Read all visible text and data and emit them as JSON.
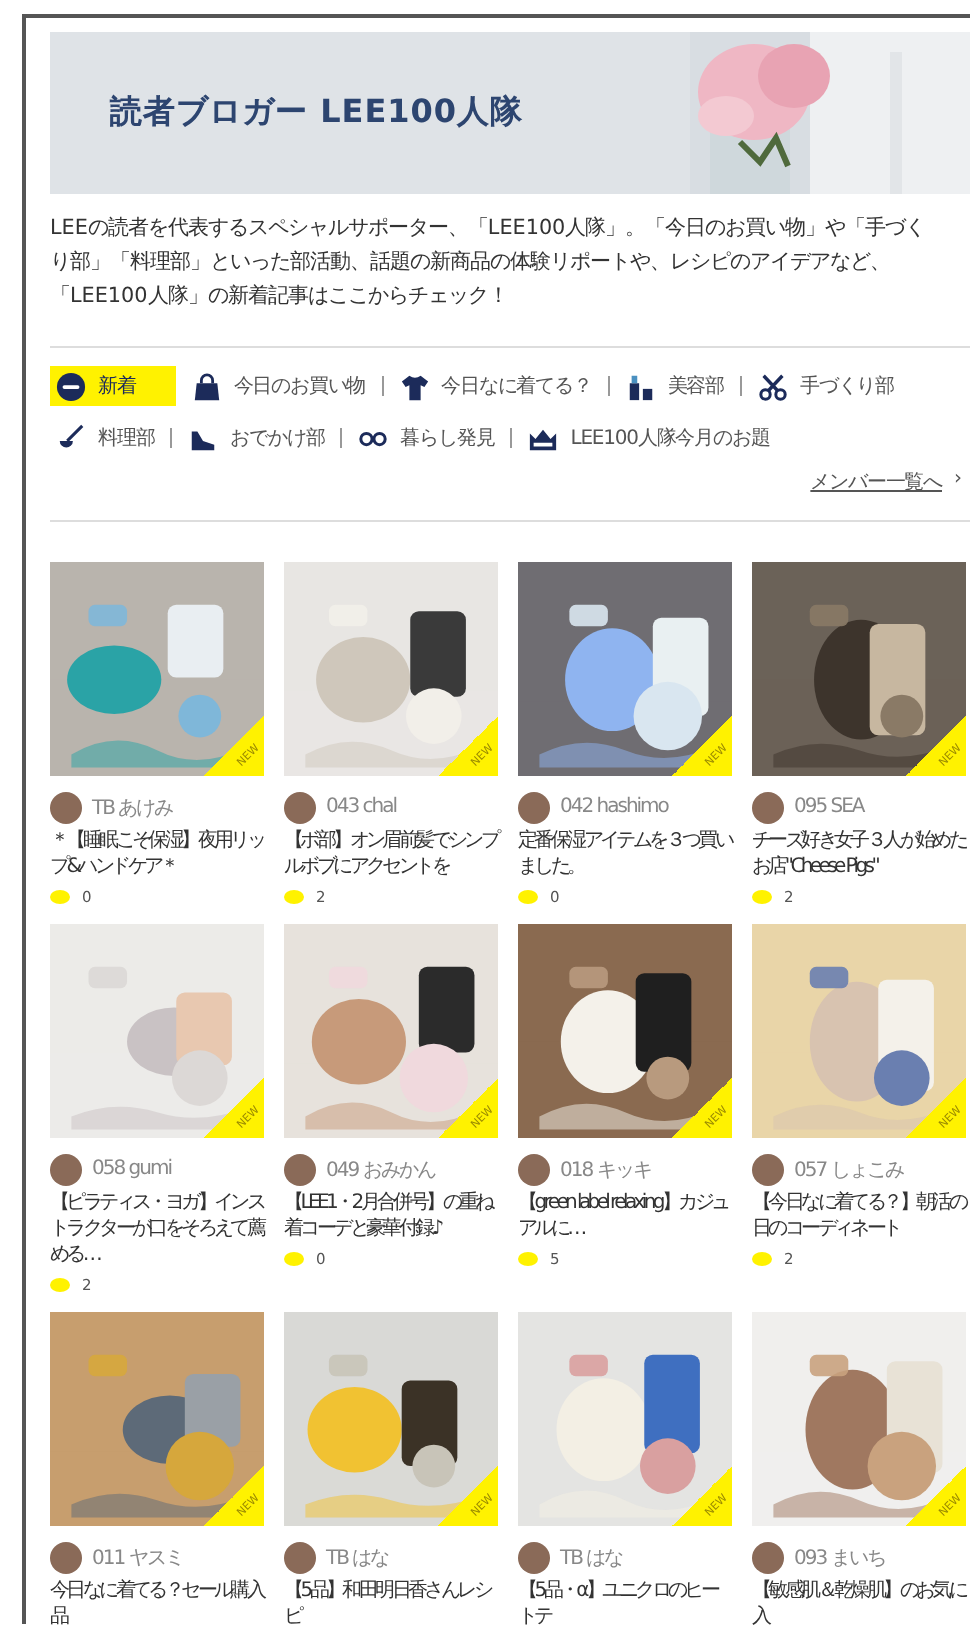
{
  "banner": {
    "title": "読者ブロガー LEE100人隊"
  },
  "description": "LEEの読者を代表するスペシャルサポーター、「LEE100人隊」。「今日のお買い物」や「手づくり部」「料理部」といった部活動、話題の新商品の体験リポートや、レシピのアイデアなど、「LEE100人隊」の新着記事はここからチェック！",
  "category_rows": [
    {
      "items": [
        {
          "kind": "new",
          "label": "新着",
          "selected": true
        },
        {
          "kind": "bag",
          "label": "今日のお買い物",
          "selected": false
        },
        {
          "kind": "shirt",
          "label": "今日なに着てる？",
          "selected": false
        },
        {
          "kind": "cosmetics",
          "label": "美容部",
          "selected": false
        },
        {
          "kind": "scissors",
          "label": "手づくり部",
          "selected": false
        }
      ]
    },
    {
      "items": [
        {
          "kind": "ladle",
          "label": "料理部",
          "selected": false
        },
        {
          "kind": "shoe",
          "label": "おでかけ部",
          "selected": false
        },
        {
          "kind": "glasses",
          "label": "暮らし発見",
          "selected": false
        },
        {
          "kind": "crown",
          "label": "LEE100人隊今月のお題",
          "selected": false
        }
      ]
    }
  ],
  "member_link": {
    "label": "メンバー一覧へ",
    "arrow": "›"
  },
  "posts": [
    {
      "badge": "NEW",
      "author": "TB あけみ",
      "title": "＊【睡眠こそ保湿】夜用リップ&ハンドケア＊",
      "comments": "0"
    },
    {
      "badge": "NEW",
      "author": "043 chal",
      "title": "【ボ部】オン眉前髪でシンプルボブにアクセントを",
      "comments": "2"
    },
    {
      "badge": "NEW",
      "author": "042 hashimo",
      "title": "定番保湿アイテムを３つ買いました。",
      "comments": "0"
    },
    {
      "badge": "NEW",
      "author": "095 SEA",
      "title": "チーズ好き女子３人が始めたお店\"Cheese Pigs\"",
      "comments": "2"
    },
    {
      "badge": "NEW",
      "author": "058 gumi",
      "title": "【ピラティス・ヨガ】インストラクターが口をそろえて薦める…",
      "comments": "2"
    },
    {
      "badge": "NEW",
      "author": "049 おみかん",
      "title": "【LEE1・2月合併号】の重ね着コーデと豪華付録♪",
      "comments": "0"
    },
    {
      "badge": "NEW",
      "author": "018 キッキ",
      "title": "【green label relaxing】カジュアルに…",
      "comments": "5"
    },
    {
      "badge": "NEW",
      "author": "057 しょこみ",
      "title": "【今日なに着てる？】朝活の日のコーディネート",
      "comments": "2"
    },
    {
      "badge": "NEW",
      "author": "011 ヤスミ",
      "title": "今日なに着てる？セール購入品"
    },
    {
      "badge": "NEW",
      "author": "TB はな",
      "title": "【5品】和田明日香さんレシピ"
    },
    {
      "badge": "NEW",
      "author": "TB はな",
      "title": "【5品・α】ユニクロのヒートテ"
    },
    {
      "badge": "NEW",
      "author": "093 まいち",
      "title": "【敏感肌＆乾燥肌】のお気に入"
    }
  ]
}
